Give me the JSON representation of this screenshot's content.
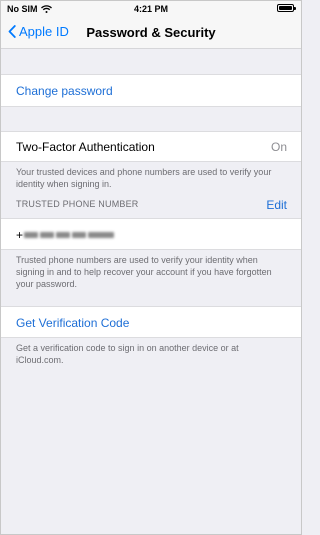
{
  "status_bar": {
    "carrier": "No SIM",
    "time": "4:21 PM",
    "wifi_icon": "wifi-icon",
    "battery_icon": "battery-icon"
  },
  "nav": {
    "back_label": "Apple ID",
    "title": "Password & Security"
  },
  "change_password": {
    "label": "Change password"
  },
  "two_factor": {
    "label": "Two-Factor Authentication",
    "value": "On",
    "description": "Your trusted devices and phone numbers are used to verify your identity when signing in."
  },
  "trusted_phone": {
    "header": "TRUSTED PHONE NUMBER",
    "edit_label": "Edit",
    "number_prefix": "+",
    "description": "Trusted phone numbers are used to verify your identity when signing in and to help recover your account if you have forgotten your password."
  },
  "verification": {
    "label": "Get Verification Code",
    "description": "Get a verification code to sign in on another device or at iCloud.com."
  },
  "colors": {
    "link": "#1e6fd6",
    "back": "#007aff",
    "background": "#efeff4"
  }
}
